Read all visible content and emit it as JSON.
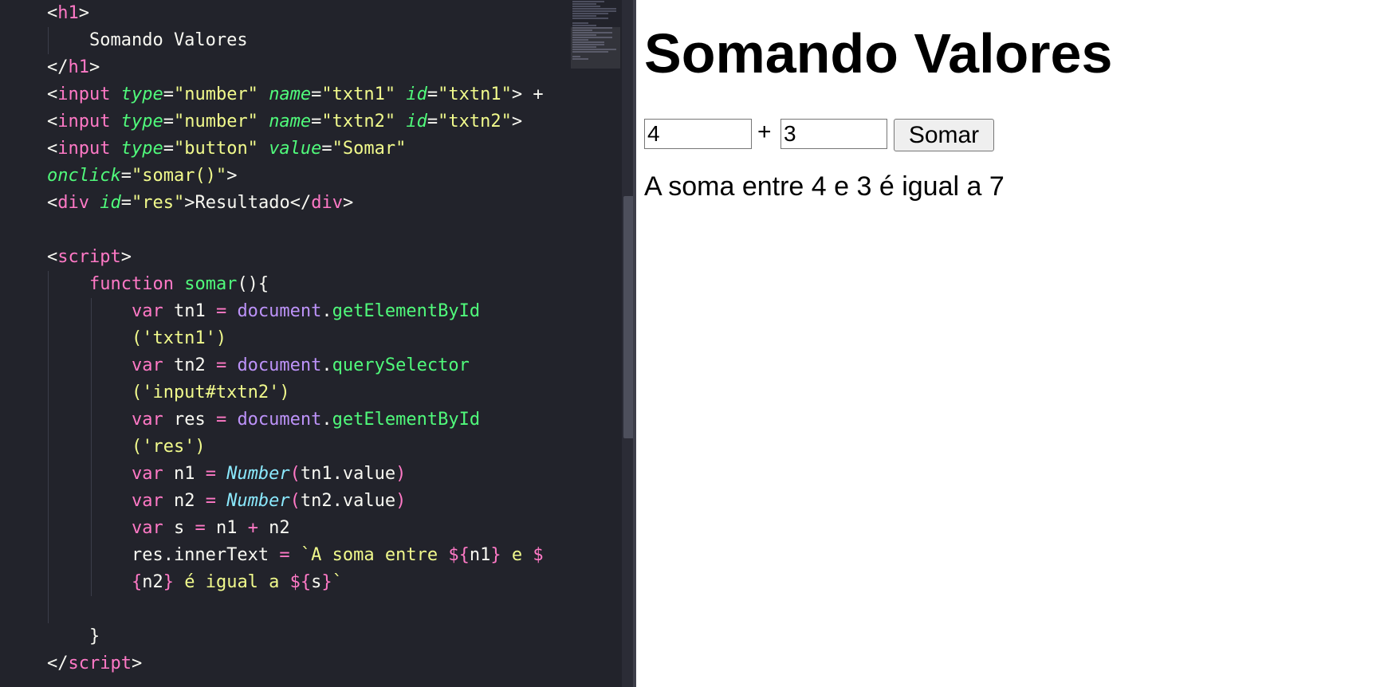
{
  "editor": {
    "lines": [
      [
        {
          "c": "punc",
          "t": "<"
        },
        {
          "c": "tag",
          "t": "h1"
        },
        {
          "c": "punc",
          "t": ">"
        }
      ],
      [
        {
          "c": "txt",
          "t": "    Somando Valores"
        }
      ],
      [
        {
          "c": "punc",
          "t": "</"
        },
        {
          "c": "tag",
          "t": "h1"
        },
        {
          "c": "punc",
          "t": ">"
        }
      ],
      [
        {
          "c": "punc",
          "t": "<"
        },
        {
          "c": "tag",
          "t": "input"
        },
        {
          "c": "txt",
          "t": " "
        },
        {
          "c": "attr",
          "t": "type"
        },
        {
          "c": "punc",
          "t": "="
        },
        {
          "c": "str",
          "t": "\"number\""
        },
        {
          "c": "txt",
          "t": " "
        },
        {
          "c": "attr",
          "t": "name"
        },
        {
          "c": "punc",
          "t": "="
        },
        {
          "c": "str",
          "t": "\"txtn1\""
        },
        {
          "c": "txt",
          "t": " "
        },
        {
          "c": "attr",
          "t": "id"
        },
        {
          "c": "punc",
          "t": "="
        },
        {
          "c": "str",
          "t": "\"txtn1\""
        },
        {
          "c": "punc",
          "t": ">"
        },
        {
          "c": "txt",
          "t": " +"
        }
      ],
      [
        {
          "c": "punc",
          "t": "<"
        },
        {
          "c": "tag",
          "t": "input"
        },
        {
          "c": "txt",
          "t": " "
        },
        {
          "c": "attr",
          "t": "type"
        },
        {
          "c": "punc",
          "t": "="
        },
        {
          "c": "str",
          "t": "\"number\""
        },
        {
          "c": "txt",
          "t": " "
        },
        {
          "c": "attr",
          "t": "name"
        },
        {
          "c": "punc",
          "t": "="
        },
        {
          "c": "str",
          "t": "\"txtn2\""
        },
        {
          "c": "txt",
          "t": " "
        },
        {
          "c": "attr",
          "t": "id"
        },
        {
          "c": "punc",
          "t": "="
        },
        {
          "c": "str",
          "t": "\"txtn2\""
        },
        {
          "c": "punc",
          "t": ">"
        }
      ],
      [
        {
          "c": "punc",
          "t": "<"
        },
        {
          "c": "tag",
          "t": "input"
        },
        {
          "c": "txt",
          "t": " "
        },
        {
          "c": "attr",
          "t": "type"
        },
        {
          "c": "punc",
          "t": "="
        },
        {
          "c": "str",
          "t": "\"button\""
        },
        {
          "c": "txt",
          "t": " "
        },
        {
          "c": "attr",
          "t": "value"
        },
        {
          "c": "punc",
          "t": "="
        },
        {
          "c": "str",
          "t": "\"Somar\""
        }
      ],
      [
        {
          "c": "attr",
          "t": "onclick"
        },
        {
          "c": "punc",
          "t": "="
        },
        {
          "c": "str",
          "t": "\"somar()\""
        },
        {
          "c": "punc",
          "t": ">"
        }
      ],
      [
        {
          "c": "punc",
          "t": "<"
        },
        {
          "c": "tag",
          "t": "div"
        },
        {
          "c": "txt",
          "t": " "
        },
        {
          "c": "attr",
          "t": "id"
        },
        {
          "c": "punc",
          "t": "="
        },
        {
          "c": "str",
          "t": "\"res\""
        },
        {
          "c": "punc",
          "t": ">"
        },
        {
          "c": "txt",
          "t": "Resultado"
        },
        {
          "c": "punc",
          "t": "</"
        },
        {
          "c": "tag",
          "t": "div"
        },
        {
          "c": "punc",
          "t": ">"
        }
      ],
      [],
      [
        {
          "c": "punc",
          "t": "<"
        },
        {
          "c": "tag",
          "t": "script"
        },
        {
          "c": "punc",
          "t": ">"
        }
      ],
      [
        {
          "c": "kw",
          "t": "    function"
        },
        {
          "c": "txt",
          "t": " "
        },
        {
          "c": "fn",
          "t": "somar"
        },
        {
          "c": "punc",
          "t": "(){"
        }
      ],
      [
        {
          "c": "kw",
          "t": "        var"
        },
        {
          "c": "txt",
          "t": " tn1 "
        },
        {
          "c": "kw",
          "t": "="
        },
        {
          "c": "txt",
          "t": " "
        },
        {
          "c": "obj",
          "t": "document"
        },
        {
          "c": "punc",
          "t": "."
        },
        {
          "c": "fn",
          "t": "getElementById"
        }
      ],
      [
        {
          "c": "str",
          "t": "        ('txtn1')"
        }
      ],
      [
        {
          "c": "kw",
          "t": "        var"
        },
        {
          "c": "txt",
          "t": " tn2 "
        },
        {
          "c": "kw",
          "t": "="
        },
        {
          "c": "txt",
          "t": " "
        },
        {
          "c": "obj",
          "t": "document"
        },
        {
          "c": "punc",
          "t": "."
        },
        {
          "c": "fn",
          "t": "querySelector"
        }
      ],
      [
        {
          "c": "str",
          "t": "        ('input#txtn2')"
        }
      ],
      [
        {
          "c": "kw",
          "t": "        var"
        },
        {
          "c": "txt",
          "t": " res "
        },
        {
          "c": "kw",
          "t": "="
        },
        {
          "c": "txt",
          "t": " "
        },
        {
          "c": "obj",
          "t": "document"
        },
        {
          "c": "punc",
          "t": "."
        },
        {
          "c": "fn",
          "t": "getElementById"
        }
      ],
      [
        {
          "c": "str",
          "t": "        ('res')"
        }
      ],
      [
        {
          "c": "kw",
          "t": "        var"
        },
        {
          "c": "txt",
          "t": " n1 "
        },
        {
          "c": "kw",
          "t": "="
        },
        {
          "c": "txt",
          "t": " "
        },
        {
          "c": "cls",
          "t": "Number"
        },
        {
          "c": "kw",
          "t": "("
        },
        {
          "c": "txt",
          "t": "tn1.value"
        },
        {
          "c": "kw",
          "t": ")"
        }
      ],
      [
        {
          "c": "kw",
          "t": "        var"
        },
        {
          "c": "txt",
          "t": " n2 "
        },
        {
          "c": "kw",
          "t": "="
        },
        {
          "c": "txt",
          "t": " "
        },
        {
          "c": "cls",
          "t": "Number"
        },
        {
          "c": "kw",
          "t": "("
        },
        {
          "c": "txt",
          "t": "tn2.value"
        },
        {
          "c": "kw",
          "t": ")"
        }
      ],
      [
        {
          "c": "kw",
          "t": "        var"
        },
        {
          "c": "txt",
          "t": " s "
        },
        {
          "c": "kw",
          "t": "="
        },
        {
          "c": "txt",
          "t": " n1 "
        },
        {
          "c": "kw",
          "t": "+"
        },
        {
          "c": "txt",
          "t": " n2"
        }
      ],
      [
        {
          "c": "txt",
          "t": "        res.innerText "
        },
        {
          "c": "kw",
          "t": "="
        },
        {
          "c": "txt",
          "t": " "
        },
        {
          "c": "tpl",
          "t": "`A soma entre "
        },
        {
          "c": "interp",
          "t": "${"
        },
        {
          "c": "txt",
          "t": "n1"
        },
        {
          "c": "interp",
          "t": "}"
        },
        {
          "c": "tpl",
          "t": " e "
        },
        {
          "c": "interp",
          "t": "$"
        }
      ],
      [
        {
          "c": "interp",
          "t": "        {"
        },
        {
          "c": "txt",
          "t": "n2"
        },
        {
          "c": "interp",
          "t": "}"
        },
        {
          "c": "tpl",
          "t": " é igual a "
        },
        {
          "c": "interp",
          "t": "${"
        },
        {
          "c": "txt",
          "t": "s"
        },
        {
          "c": "interp",
          "t": "}"
        },
        {
          "c": "tpl",
          "t": "`"
        }
      ],
      [],
      [
        {
          "c": "punc",
          "t": "    }"
        }
      ],
      [
        {
          "c": "punc",
          "t": "</"
        },
        {
          "c": "tag",
          "t": "script"
        },
        {
          "c": "punc",
          "t": ">"
        }
      ]
    ]
  },
  "preview": {
    "heading": "Somando Valores",
    "input1_value": "4",
    "plus": "+",
    "input2_value": "3",
    "button_label": "Somar",
    "result": "A soma entre 4 e 3 é igual a 7"
  },
  "colors": {
    "editor_bg": "#22232b",
    "tag": "#ff79c6",
    "attribute": "#50fa7b",
    "string": "#f1fa8c",
    "object": "#bd93f9",
    "class": "#8be9fd"
  }
}
